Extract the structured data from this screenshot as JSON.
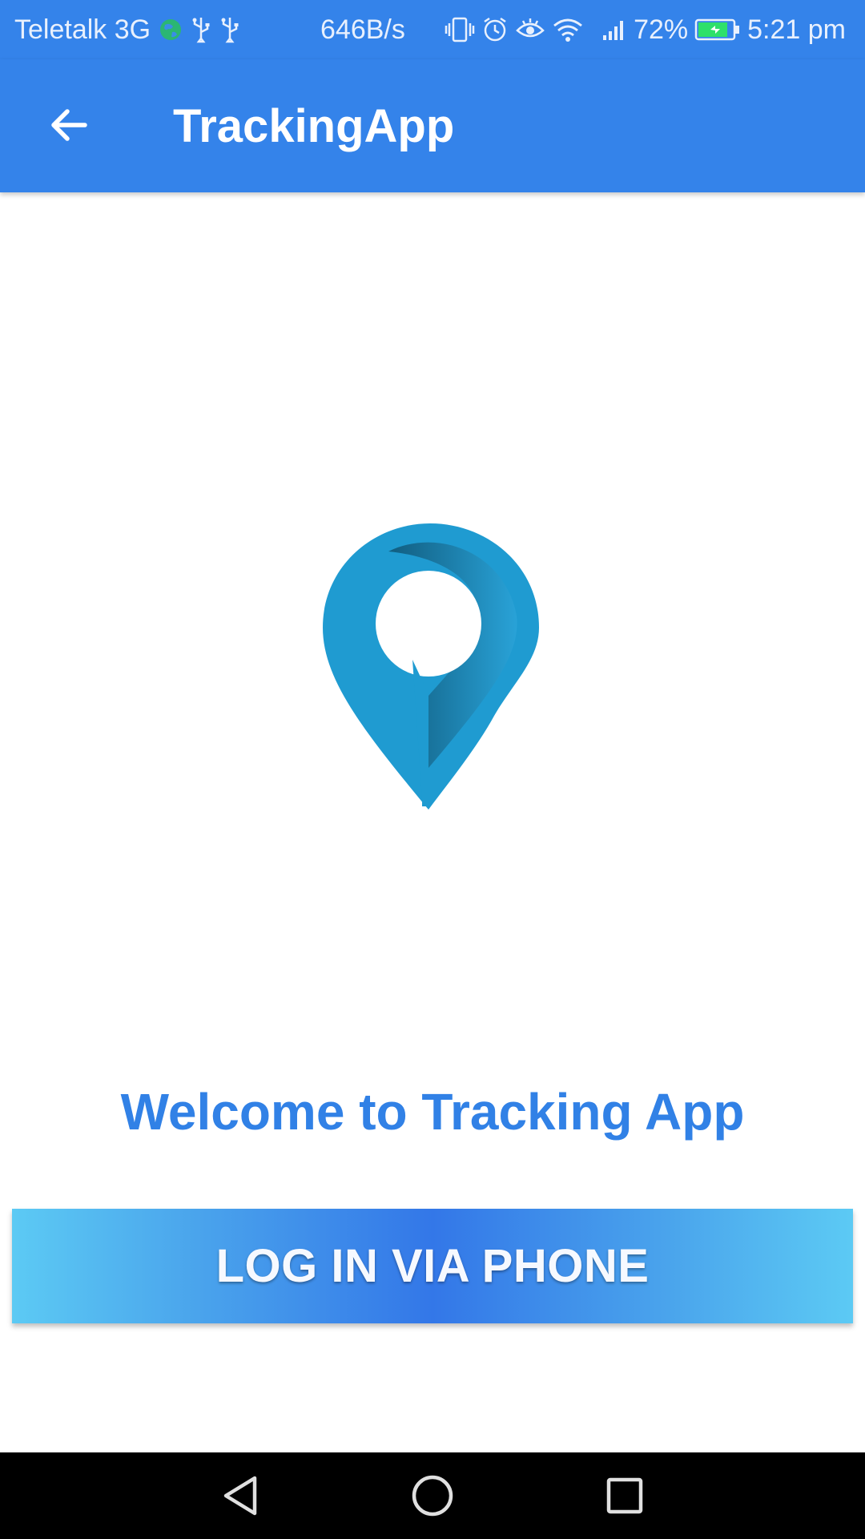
{
  "status_bar": {
    "carrier": "Teletalk 3G",
    "net_speed": "646B/s",
    "battery_percent": "72%",
    "time": "5:21 pm",
    "icons": [
      "globe-icon",
      "usb-icon",
      "usb-icon",
      "vibrate-icon",
      "alarm-icon",
      "eye-icon",
      "wifi-icon",
      "signal-icon",
      "battery-charging-icon"
    ]
  },
  "app_bar": {
    "title": "TrackingApp",
    "back_icon": "arrow-back-icon"
  },
  "main": {
    "logo_icon": "location-pin-logo",
    "welcome_text": "Welcome to Tracking App",
    "login_button_label": "LOG IN VIA PHONE"
  },
  "nav_bar": {
    "icons": [
      "nav-back-icon",
      "nav-home-icon",
      "nav-recents-icon"
    ]
  },
  "colors": {
    "primary": "#3483ea",
    "welcome_text": "#3181e6",
    "logo": "#1f9bd1",
    "nav_bar": "#000000"
  }
}
